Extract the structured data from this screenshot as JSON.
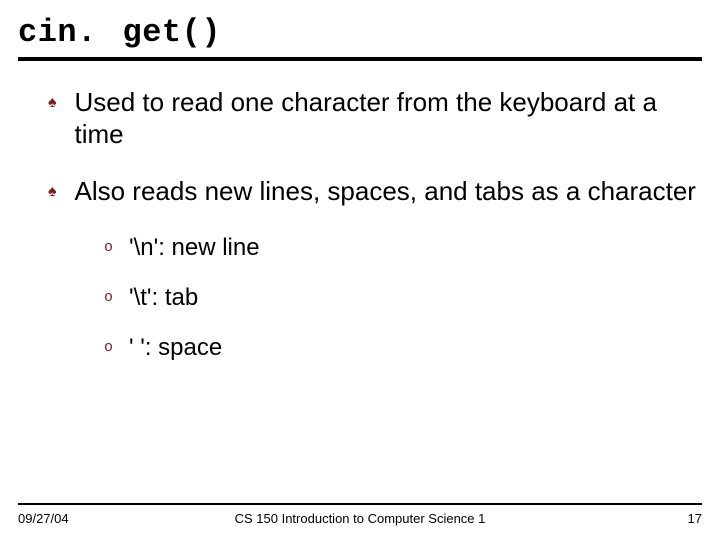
{
  "title": "cin. get()",
  "bullets": [
    "Used to read one character from the keyboard at a time",
    "Also reads new lines, spaces, and tabs as a character"
  ],
  "sub_bullets": [
    "'\\n': new line",
    "'\\t': tab",
    "' ': space"
  ],
  "footer": {
    "date": "09/27/04",
    "course": "CS 150 Introduction to Computer Science 1",
    "page": "17"
  }
}
